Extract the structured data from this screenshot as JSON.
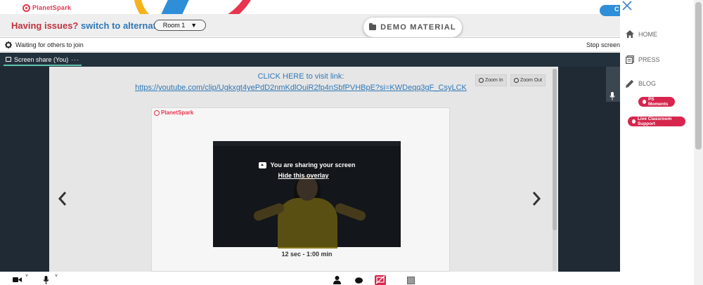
{
  "header": {
    "logo_text": "PlanetSpark"
  },
  "issue_bar": {
    "question": "Having issues?",
    "link": "switch to alternate room",
    "room_selected": "Room 1",
    "room_caret": "▼",
    "demo_button": "DEMO MATERIAL",
    "chat_tab_letter": "C"
  },
  "meeting": {
    "waiting_text": "Waiting for others to join",
    "stop_text": "Stop screen",
    "share_tab_label": "Screen share (You)",
    "share_tab_menu": "···",
    "click_here": "CLICK HERE to visit link:",
    "youtube_link": "https://youtube.com/clip/Ugkxgt4yePdD2nmKdlOuiR2fp4nSbfPVHBpE?si=KWDeqq3gF_CsyLCK",
    "zoom_in": "Zoom In",
    "zoom_out": "Zoom Out",
    "slide_logo": "PlanetSpark",
    "sharing_message": "You are sharing your screen",
    "hide_overlay": "Hide this overlay",
    "video_timer": "12 sec - 1:00 min"
  },
  "toolbar": {
    "video_caret": "˅",
    "mic_caret": "˅"
  },
  "rightnav": {
    "items": [
      {
        "label": "HOME",
        "icon": "home-icon"
      },
      {
        "label": "PRESS",
        "icon": "press-icon"
      },
      {
        "label": "BLOG",
        "icon": "pencil-icon"
      }
    ],
    "pill_moments": "PS Moments",
    "pill_support": "Live Classroom Support"
  },
  "colors": {
    "brand_red": "#e8344e",
    "link_blue": "#2f78b7",
    "accent_pink": "#d6264d",
    "dark_stage": "#1f2a34"
  }
}
